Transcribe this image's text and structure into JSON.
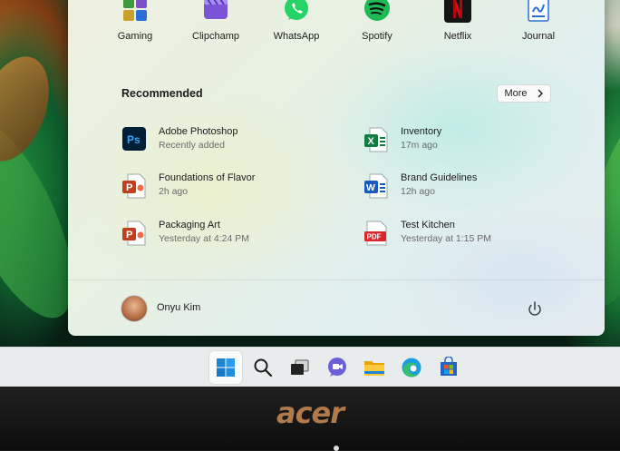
{
  "pinned_apps": [
    {
      "label": "Gaming",
      "icon": "gaming-icon"
    },
    {
      "label": "Clipchamp",
      "icon": "clipchamp-icon"
    },
    {
      "label": "WhatsApp",
      "icon": "whatsapp-icon"
    },
    {
      "label": "Spotify",
      "icon": "spotify-icon"
    },
    {
      "label": "Netflix",
      "icon": "netflix-icon"
    },
    {
      "label": "Journal",
      "icon": "journal-icon"
    }
  ],
  "recommended": {
    "title": "Recommended",
    "more_label": "More",
    "items": [
      {
        "name": "Adobe Photoshop",
        "time": "Recently added",
        "icon": "photoshop-icon",
        "icon_text": "Ps",
        "color": "#001e36",
        "accent": "#31a8ff"
      },
      {
        "name": "Inventory",
        "time": "17m ago",
        "icon": "excel-icon",
        "icon_text": "X",
        "color": "#107c41"
      },
      {
        "name": "Foundations of Flavor",
        "time": "2h ago",
        "icon": "powerpoint-icon",
        "icon_text": "P",
        "color": "#c43e1c"
      },
      {
        "name": "Brand Guidelines",
        "time": "12h ago",
        "icon": "word-icon",
        "icon_text": "W",
        "color": "#185abd"
      },
      {
        "name": "Packaging Art",
        "time": "Yesterday at 4:24 PM",
        "icon": "powerpoint-icon",
        "icon_text": "P",
        "color": "#c43e1c"
      },
      {
        "name": "Test Kitchen",
        "time": "Yesterday at 1:15 PM",
        "icon": "pdf-icon",
        "icon_text": "PDF",
        "color": "#d9262a"
      }
    ]
  },
  "user": {
    "name": "Onyu Kim"
  },
  "taskbar": {
    "items": [
      "start-icon",
      "search-icon",
      "task-view-icon",
      "teams-chat-icon",
      "file-explorer-icon",
      "edge-icon",
      "store-icon"
    ]
  },
  "device": {
    "brand": "acer"
  }
}
